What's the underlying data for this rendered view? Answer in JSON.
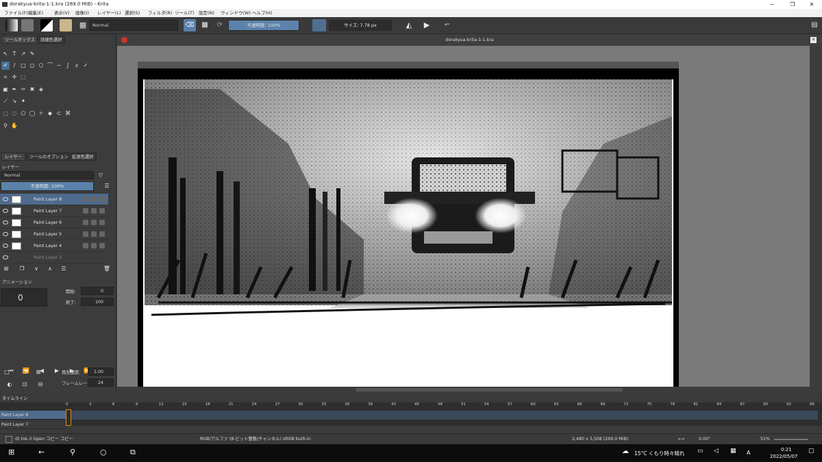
{
  "window": {
    "title": "dorakyua-krita-1-1.kra (269.0 MiB)  - Krita",
    "minimize": "─",
    "maximize": "❐",
    "close": "✕"
  },
  "menu": [
    "ファイル(F)",
    "編集(E)",
    "表示(V)",
    "画像(I)",
    "レイヤー(L)",
    "選択(S)",
    "フィルタ(R)",
    "ツール(T)",
    "設定(N)",
    "ウィンドウ(W)",
    "ヘルプ(H)"
  ],
  "toolbar": {
    "blend_mode": "Normal",
    "opacity": "不透明度: 100%",
    "size": "サイズ: 7.78 px"
  },
  "toolbox": {
    "tabs": [
      "ツールボックス",
      "詳細色選択"
    ]
  },
  "docker_tabs": [
    "レイヤー",
    "ツールのオプション",
    "拡張色選択"
  ],
  "layers": {
    "title": "レイヤー",
    "blend": "Normal",
    "opacity": "不透明度: 100%",
    "items": [
      "Paint Layer 8",
      "Paint Layer 7",
      "Paint Layer 6",
      "Paint Layer 5",
      "Paint Layer 4",
      "Paint Layer 3"
    ]
  },
  "animation": {
    "title": "アニメーション",
    "frame": "0",
    "start_label": "開始:",
    "start": "0",
    "end_label": "終了:",
    "end": "100",
    "speed_label": "再生速度:",
    "speed": "1.00",
    "fps_label": "フレームレート:",
    "fps": "24"
  },
  "document": {
    "tab_title": "dorakyua-krita-1-1.kra"
  },
  "timeline": {
    "title": "タイムライン",
    "ticks": [
      "0",
      "3",
      "6",
      "9",
      "12",
      "15",
      "18",
      "21",
      "24",
      "27",
      "30",
      "33",
      "36",
      "39",
      "42",
      "45",
      "48",
      "51",
      "54",
      "57",
      "60",
      "63",
      "66",
      "69",
      "72",
      "75",
      "78",
      "81",
      "84",
      "87",
      "90",
      "93",
      "96"
    ],
    "rows": [
      "Paint Layer 8",
      "Paint Layer 7"
    ]
  },
  "status": {
    "brush": "d) Ink-3 Gpen コピー コピー",
    "color": "RGB/アルファ (8-ビット整数/チャンネル)  sRGB built-in",
    "size": "2,480 x 3,508 (269.0 MiB)",
    "rotation": "0.00°",
    "zoom": "51%"
  },
  "taskbar": {
    "weather": "15°C  くもり時々晴れ",
    "time": "0:21",
    "date": "2022/05/07",
    "ime": "A"
  }
}
